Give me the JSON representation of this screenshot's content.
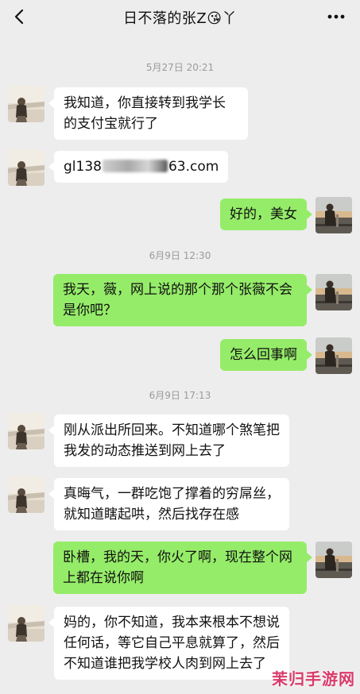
{
  "header": {
    "title": "日不落的张Z😘丫"
  },
  "timestamps": [
    "5月27日 20:21",
    "6月9日 12:30",
    "6月9日 17:13"
  ],
  "messages": [
    {
      "side": "in",
      "text": "我知道，你直接转到我学长的支付宝就行了"
    },
    {
      "side": "in",
      "text_prefix": "gl138",
      "text_suffix": "63.com",
      "redacted": true
    },
    {
      "side": "out",
      "text": "好的，美女"
    },
    {
      "side": "out",
      "text": "我天，薇，网上说的那个那个张薇不会是你吧？"
    },
    {
      "side": "out",
      "text": "怎么回事啊"
    },
    {
      "side": "in",
      "text": "刚从派出所回来。不知道哪个煞笔把我发的动态推送到网上去了"
    },
    {
      "side": "in",
      "text": "真晦气，一群吃饱了撑着的穷屌丝，就知道瞎起哄，然后找存在感"
    },
    {
      "side": "out",
      "text": "卧槽，我的天，你火了啊，现在整个网上都在说你啊"
    },
    {
      "side": "in",
      "text": "妈的，你不知道，我本来根本不想说任何话，等它自己平息就算了，然后不知道谁把我学校人肉到网上去了"
    }
  ],
  "watermark": "茉归手游网",
  "colors": {
    "background": "#ededed",
    "incoming_bubble": "#ffffff",
    "outgoing_bubble": "#95ec69",
    "timestamp": "#9a9a9a"
  },
  "icons": {
    "back": "chevron-left-icon",
    "more": "more-dots-icon"
  }
}
